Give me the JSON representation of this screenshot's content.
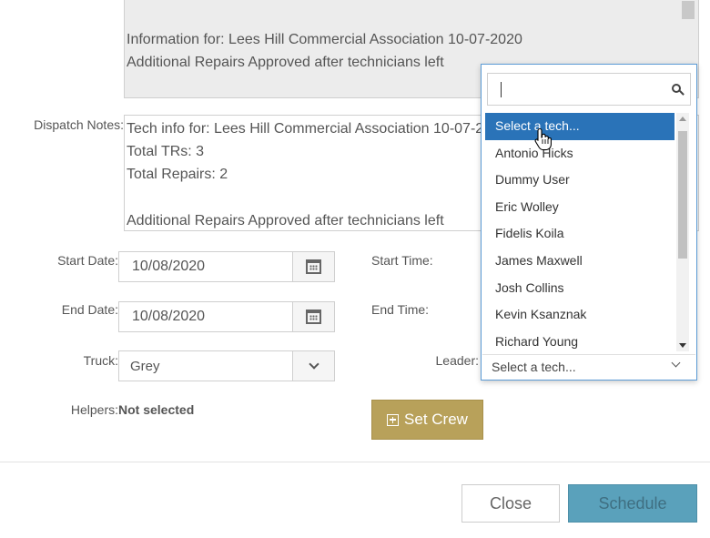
{
  "info_area": {
    "lines": [
      "Information for: Lees Hill Commercial Association 10-07-2020",
      "Additional Repairs Approved after technicians left"
    ]
  },
  "dispatch_notes": {
    "label": "Dispatch Notes:",
    "lines": [
      "Tech info for: Lees Hill Commercial Association 10-07-2020",
      "Total TRs: 3",
      "Total Repairs: 2",
      "",
      "Additional Repairs Approved after technicians left"
    ]
  },
  "form": {
    "start_date_label": "Start Date:",
    "start_date_value": "10/08/2020",
    "end_date_label": "End Date:",
    "end_date_value": "10/08/2020",
    "start_time_label": "Start Time:",
    "end_time_label": "End Time:",
    "truck_label": "Truck:",
    "truck_value": "Grey",
    "leader_label": "Leader:",
    "helpers_label": "Helpers:",
    "helpers_value": "Not selected",
    "set_crew_label": "Set Crew"
  },
  "tech_dropdown": {
    "search_value": "",
    "options": [
      "Select a tech...",
      "Antonio Hicks",
      "Dummy User",
      "Eric Wolley",
      "Fidelis Koila",
      "James Maxwell",
      "Josh Collins",
      "Kevin Ksanznak",
      "Richard Young"
    ],
    "highlighted_index": 0,
    "selected_value": "Select a tech..."
  },
  "footer": {
    "close_label": "Close",
    "schedule_label": "Schedule"
  },
  "colors": {
    "highlight": "#2a73b8",
    "set_crew": "#b8a15a",
    "schedule": "#5aa1bb"
  }
}
